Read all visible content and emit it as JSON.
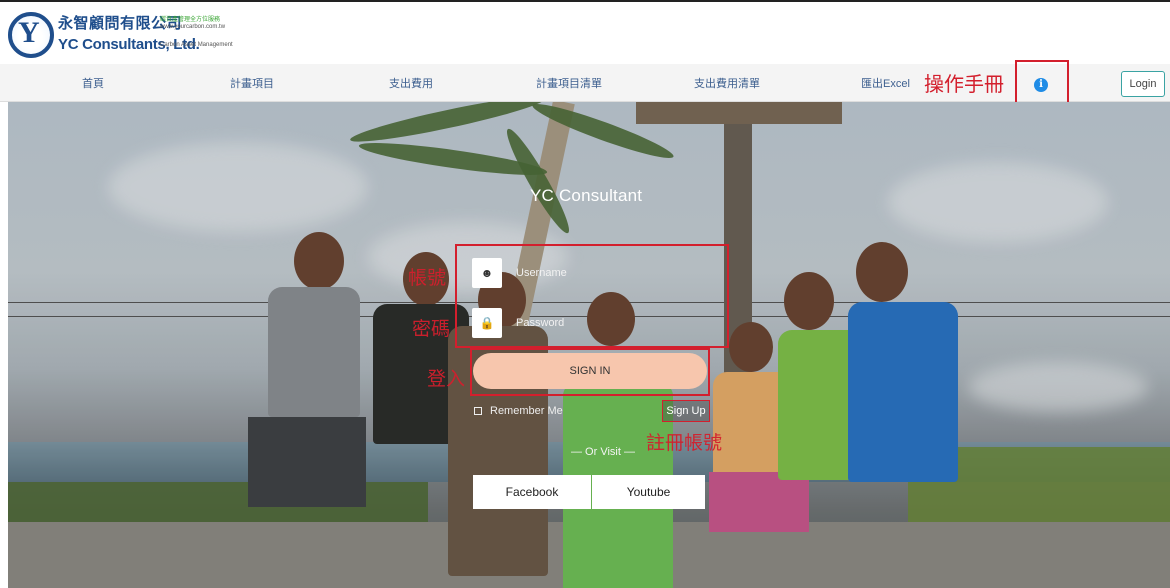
{
  "brand": {
    "name_cn": "永智顧問有限公司",
    "name_en": "YC Consultants, Ltd.",
    "small_line1": "碳資產管理全方位服務",
    "small_line2": "www.yourcarbon.com.tw",
    "small_line3": "Carbon Asset Management"
  },
  "nav": {
    "items": [
      {
        "label": "首頁"
      },
      {
        "label": "計畫項目"
      },
      {
        "label": "支出費用"
      },
      {
        "label": "計畫項目清單"
      },
      {
        "label": "支出費用清單"
      },
      {
        "label": "匯出Excel"
      }
    ],
    "manual_annotation": "操作手冊",
    "info_icon": "i",
    "login_label": "Login"
  },
  "login_form": {
    "title": "YC Consultant",
    "username_placeholder": "Username",
    "password_placeholder": "Password",
    "signin_label": "SIGN IN",
    "remember_label": "Remember Me",
    "signup_label": "Sign Up",
    "or_visit": "— Or Visit —",
    "facebook_label": "Facebook",
    "youtube_label": "Youtube"
  },
  "annotations": {
    "account": "帳號",
    "password": "密碼",
    "login": "登入",
    "register": "註冊帳號"
  },
  "colors": {
    "annotation_red": "#d31f2d",
    "nav_link": "#3d5f8f",
    "signin_button": "#f7c6ad",
    "info_blue": "#1f8ce6"
  }
}
